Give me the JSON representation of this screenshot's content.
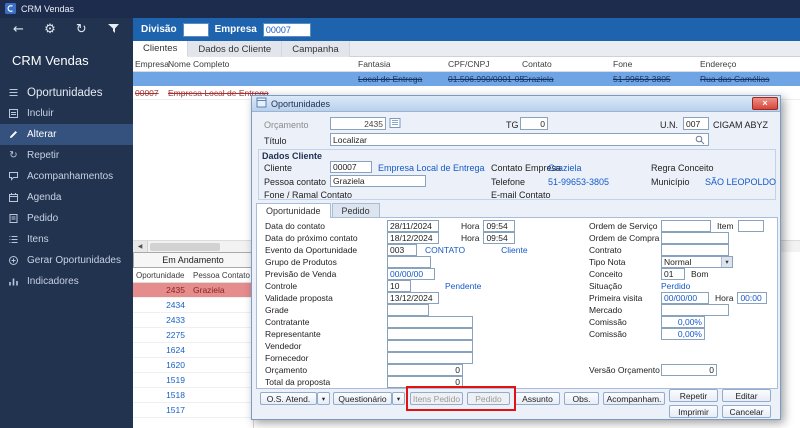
{
  "window": {
    "title": "CRM Vendas"
  },
  "icons": {
    "back": "←",
    "settings": "⚙",
    "refresh": "↻",
    "caret_down": "▾",
    "close": "×",
    "scroll_left": "◀",
    "repeat": "↻"
  },
  "toolbar": {
    "division_label": "Divisão",
    "division_value": "",
    "company_label": "Empresa",
    "company_value": "00007"
  },
  "main_tabs": {
    "clientes": "Clientes",
    "dados": "Dados do Cliente",
    "campanha": "Campanha"
  },
  "sidebar": {
    "app_title": "CRM Vendas",
    "section_title": "Oportunidades",
    "items": {
      "incluir": "Incluir",
      "alterar": "Alterar",
      "repetir": "Repetir",
      "acompanhamentos": "Acompanhamentos",
      "agenda": "Agenda",
      "pedido": "Pedido",
      "itens": "Itens",
      "gerar": "Gerar Oportunidades",
      "indicadores": "Indicadores"
    }
  },
  "grid": {
    "headers": {
      "empresa": "Empresa",
      "nome": "Nome Completo",
      "fantasia": "Fantasia",
      "cnpj": "CPF/CNPJ",
      "contato": "Contato",
      "fone": "Fone",
      "endereco": "Endereço"
    },
    "row1": {
      "fantasia": "Local de Entrega",
      "cnpj": "01.506.990/0001-05",
      "contato": "Graziela",
      "fone": "51-99653-3805",
      "endereco": "Rua das Camélias"
    },
    "row2": {
      "empresa": "00007",
      "nome": "Empresa Local de Entrega"
    }
  },
  "queue": {
    "header": "Em Andamento",
    "col_oportunidade": "Oportunidade",
    "col_contato": "Pessoa Contato",
    "rows": [
      {
        "id": "2435",
        "contact": "Graziela"
      },
      {
        "id": "2434",
        "contact": ""
      },
      {
        "id": "2433",
        "contact": ""
      },
      {
        "id": "2275",
        "contact": ""
      },
      {
        "id": "1624",
        "contact": ""
      },
      {
        "id": "1620",
        "contact": ""
      },
      {
        "id": "1519",
        "contact": ""
      },
      {
        "id": "1518",
        "contact": ""
      },
      {
        "id": "1517",
        "contact": ""
      }
    ]
  },
  "dialog": {
    "title": "Oportunidades",
    "orcamento": {
      "label": "Orçamento",
      "value": "2435"
    },
    "tg": {
      "label": "TG",
      "value": "0"
    },
    "un": {
      "label": "U.N.",
      "value": "007",
      "name": "CIGAM ABYZ"
    },
    "titulo": {
      "label": "Título",
      "value": "Localizar"
    },
    "dados_cliente": {
      "title": "Dados Cliente",
      "cliente_label": "Cliente",
      "cliente_code": "00007",
      "cliente_name": "Empresa Local de Entrega",
      "contato_empresa_label": "Contato Empresa",
      "contato_empresa": "Graziela",
      "regra_label": "Regra Conceito",
      "pessoa_label": "Pessoa contato",
      "pessoa": "Graziela",
      "telefone_label": "Telefone",
      "telefone": "51-99653-3805",
      "municipio_label": "Município",
      "municipio": "SÃO LEOPOLDO",
      "fone_ramal_label": "Fone / Ramal Contato",
      "email_label": "E-mail Contato"
    },
    "tabs": {
      "oportunidade": "Oportunidade",
      "pedido": "Pedido"
    },
    "form": {
      "data_contato": {
        "label": "Data do contato",
        "value": "28/11/2024",
        "hora_label": "Hora",
        "hora": "09:54"
      },
      "data_proximo": {
        "label": "Data do próximo contato",
        "value": "18/12/2024",
        "hora_label": "Hora",
        "hora": "09:54"
      },
      "evento": {
        "label": "Evento da Oportunidade",
        "value": "003",
        "desc": "CONTATO",
        "tipo": "Cliente"
      },
      "grupo": {
        "label": "Grupo de Produtos",
        "value": ""
      },
      "previsao": {
        "label": "Previsão de Venda",
        "value": "00/00/00"
      },
      "controle": {
        "label": "Controle",
        "value": "10",
        "status": "Pendente"
      },
      "validade": {
        "label": "Validade proposta",
        "value": "13/12/2024"
      },
      "grade": {
        "label": "Grade",
        "value": ""
      },
      "contratante": {
        "label": "Contratante",
        "value": ""
      },
      "representante": {
        "label": "Representante",
        "value": ""
      },
      "vendedor": {
        "label": "Vendedor",
        "value": ""
      },
      "fornecedor": {
        "label": "Fornecedor",
        "value": ""
      },
      "orcamento2": {
        "label": "Orçamento",
        "value": "0"
      },
      "total": {
        "label": "Total da proposta",
        "value": "0"
      },
      "ordem_servico": {
        "label": "Ordem de Serviço",
        "value": "",
        "item_label": "Item",
        "item": ""
      },
      "ordem_compra": {
        "label": "Ordem de Compra",
        "value": ""
      },
      "contrato": {
        "label": "Contrato",
        "value": ""
      },
      "tipo_nota": {
        "label": "Tipo Nota",
        "value": "Normal"
      },
      "conceito": {
        "label": "Conceito",
        "value": "01",
        "desc": "Bom"
      },
      "situacao": {
        "label": "Situação",
        "value": "Perdido"
      },
      "primeira_visita": {
        "label": "Primeira visita",
        "value": "00/00/00",
        "hora_label": "Hora",
        "hora": "00:00"
      },
      "mercado": {
        "label": "Mercado",
        "value": ""
      },
      "comissao1": {
        "label": "Comissão",
        "value": "0,00%"
      },
      "comissao2": {
        "label": "Comissão",
        "value": "0,00%"
      },
      "versao": {
        "label": "Versão Orçamento",
        "value": "0"
      }
    },
    "buttons": {
      "os_atend": "O.S. Atend.",
      "questionario": "Questionário",
      "itens_pedido": "Itens Pedido",
      "pedido": "Pedido",
      "assunto": "Assunto",
      "obs": "Obs.",
      "acompanham": "Acompanham.",
      "repetir": "Repetir",
      "editar": "Editar",
      "imprimir": "Imprimir",
      "cancelar": "Cancelar"
    }
  }
}
